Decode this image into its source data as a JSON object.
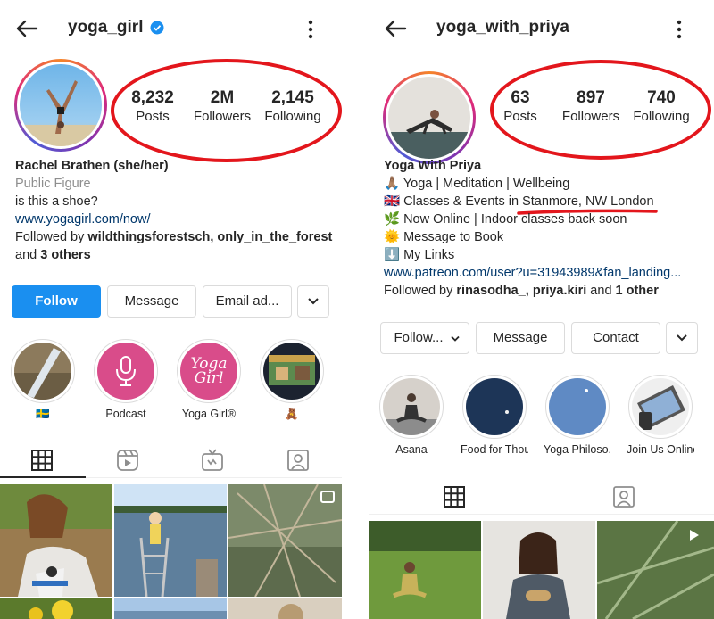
{
  "left": {
    "username": "yoga_girl",
    "stats": [
      {
        "value": "8,232",
        "label": "Posts"
      },
      {
        "value": "2M",
        "label": "Followers"
      },
      {
        "value": "2,145",
        "label": "Following"
      }
    ],
    "name": "Rachel Brathen (she/her)",
    "category": "Public Figure",
    "bio": "is this a shoe?",
    "link": "www.yogagirl.com/now/",
    "followed_prefix": "Followed by ",
    "followed_names": "wildthingsforestsch, only_in_the_forest",
    "followed_and": "and ",
    "followed_others": "3 others",
    "buttons": {
      "follow": "Follow",
      "message": "Message",
      "email": "Email ad..."
    },
    "highlights": [
      "🇸🇪",
      "Podcast",
      "Yoga Girl®",
      "🧸"
    ],
    "yoga_girl_logo": [
      "Yoga",
      "Girl"
    ]
  },
  "right": {
    "username": "yoga_with_priya",
    "stats": [
      {
        "value": "63",
        "label": "Posts"
      },
      {
        "value": "897",
        "label": "Followers"
      },
      {
        "value": "740",
        "label": "Following"
      }
    ],
    "name": "Yoga With Priya",
    "bio_lines": [
      "🙏🏽 Yoga | Meditation | Wellbeing",
      "🇬🇧 Classes & Events in ",
      "🌿 Now Online | Indoor classes back soon",
      "🌞 Message to Book",
      "⬇️ My Links"
    ],
    "location": "Stanmore, NW London",
    "link": "www.patreon.com/user?u=31943989&fan_landing...",
    "followed_prefix": "Followed by ",
    "followed_names": "rinasodha_, priya.kiri",
    "followed_and": " and ",
    "followed_others": "1 other",
    "buttons": {
      "follow": "Follow...",
      "message": "Message",
      "contact": "Contact"
    },
    "highlights": [
      "Asana",
      "Food for Thou...",
      "Yoga Philoso...",
      "Join Us Online"
    ]
  },
  "icons": {
    "back": "arrow-left",
    "more": "kebab",
    "verified": "verified-badge",
    "grid": "grid",
    "reels": "reels",
    "igtv": "igtv",
    "tagged": "tagged",
    "chevron": "chevron-down"
  },
  "colors": {
    "accent": "#1a8ff0",
    "annotation": "#e3161c",
    "link": "#00376b"
  }
}
